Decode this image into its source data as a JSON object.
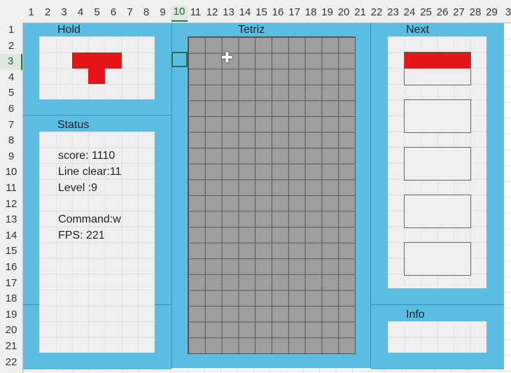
{
  "spreadsheet": {
    "column_headers": [
      "1",
      "2",
      "3",
      "4",
      "5",
      "6",
      "7",
      "8",
      "9",
      "10",
      "11",
      "12",
      "13",
      "14",
      "15",
      "16",
      "17",
      "18",
      "19",
      "20",
      "21",
      "22",
      "23",
      "24",
      "25",
      "26",
      "27",
      "28",
      "29",
      "3"
    ],
    "row_headers": [
      "1",
      "2",
      "3",
      "4",
      "5",
      "6",
      "7",
      "8",
      "9",
      "10",
      "11",
      "12",
      "13",
      "14",
      "15",
      "16",
      "17",
      "18",
      "19",
      "20",
      "21",
      "22"
    ],
    "selected_column": "10",
    "selected_row": "3"
  },
  "panels": {
    "hold_title": "Hold",
    "game_title": "Tetriz",
    "next_title": "Next",
    "status_title": "Status",
    "info_title": "Info"
  },
  "status": {
    "score": "score: 1110",
    "line_clear": "Line clear:11",
    "level": "Level :9",
    "command": "Command:w",
    "fps": "FPS:  221"
  },
  "colors": {
    "frame": "#5bbde2",
    "piece": "#e8141a",
    "board": "#9e9e9e"
  },
  "icons": {
    "cursor": "plus-cursor-icon"
  }
}
